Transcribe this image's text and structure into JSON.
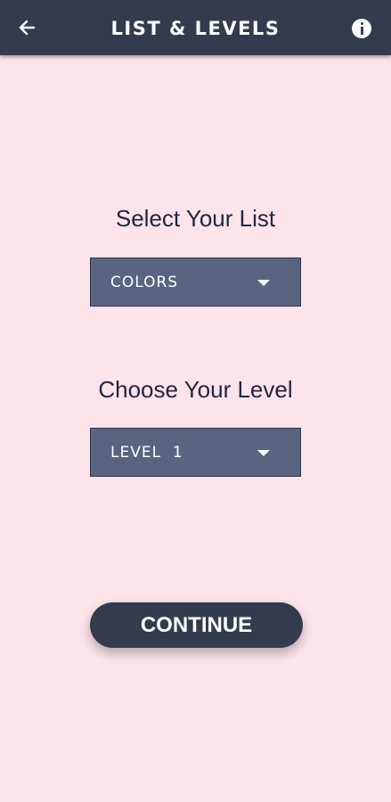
{
  "header": {
    "title": "LIST & LEVELS",
    "back_icon": "arrow-left-icon",
    "info_icon": "info-icon"
  },
  "list_section": {
    "label": "Select Your List",
    "selected": "COLORS"
  },
  "level_section": {
    "label": "Choose Your Level",
    "selected": "LEVEL  1"
  },
  "continue_label": "CONTINUE",
  "colors": {
    "background": "#fce4ea",
    "app_bar": "#343b4d",
    "dropdown": "#5a6482",
    "text_dark": "#1f2740"
  }
}
